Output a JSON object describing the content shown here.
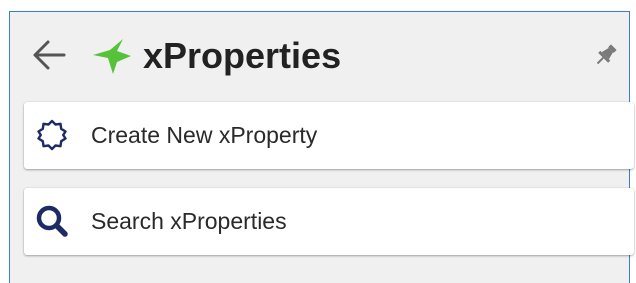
{
  "header": {
    "title": "xProperties",
    "back_icon": "arrow-left-icon",
    "logo_icon": "xproperties-logo-icon",
    "pin_icon": "pin-icon"
  },
  "actions": [
    {
      "label": "Create New xProperty",
      "icon": "gear-outline-icon"
    },
    {
      "label": "Search xProperties",
      "icon": "search-icon"
    }
  ],
  "colors": {
    "panel_background": "#f0f0f0",
    "panel_border": "#3d7fc4",
    "logo_green": "#56c23a",
    "icon_navy": "#1c2b66",
    "text": "#222222"
  }
}
